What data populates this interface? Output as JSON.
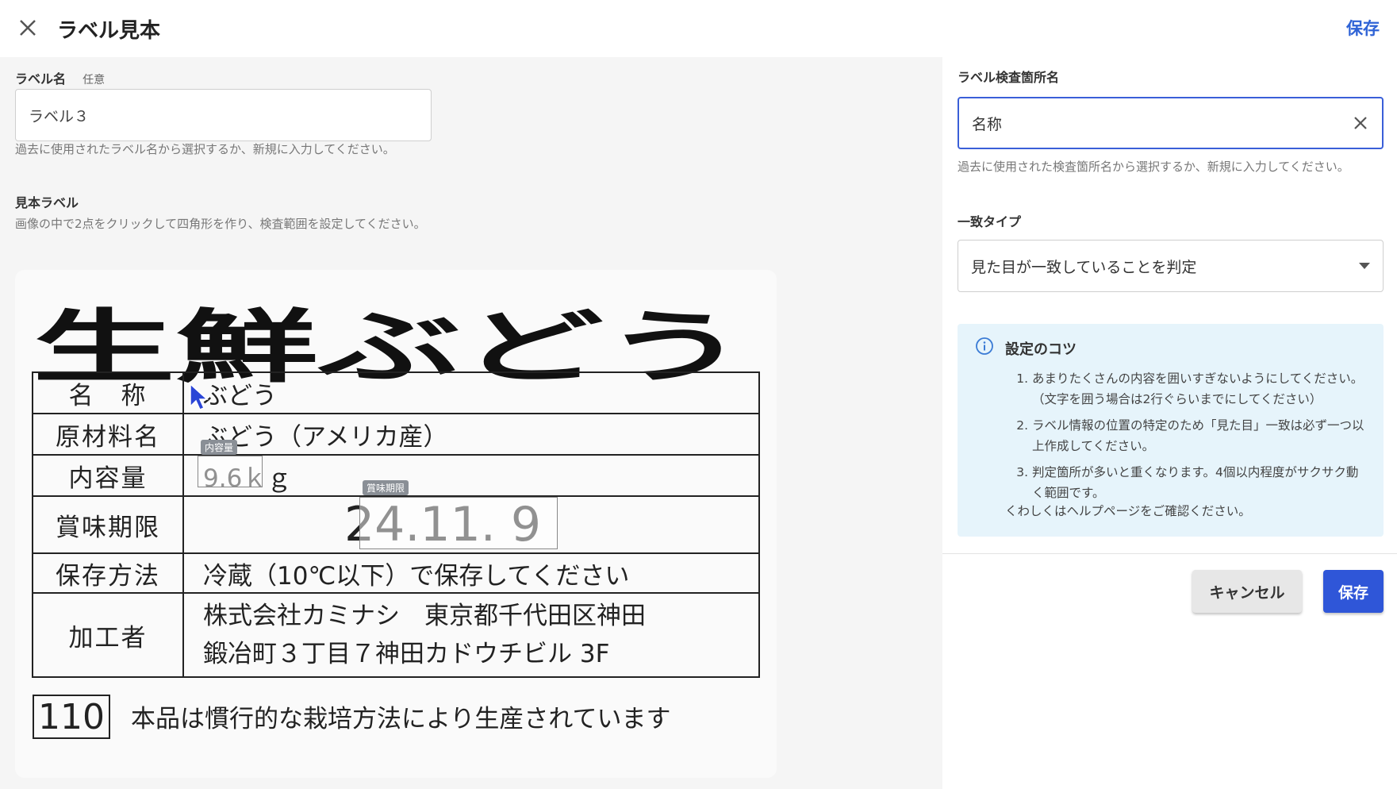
{
  "header": {
    "title": "ラベル見本",
    "save_label": "保存",
    "close_icon": "close-icon"
  },
  "left": {
    "label_name": {
      "label": "ラベル名",
      "optional": "任意",
      "value": "ラベル３",
      "help": "過去に使用されたラベル名から選択するか、新規に入力してください。"
    },
    "sample": {
      "label": "見本ラベル",
      "help": "画像の中で2点をクリックして四角形を作り、検査範囲を設定してください。",
      "image": {
        "title": "生鮮ぶどう",
        "rows": [
          {
            "head": "名　称",
            "value": "ぶどう"
          },
          {
            "head": "原材料名",
            "value": "ぶどう（アメリカ産）"
          },
          {
            "head": "内容量",
            "value": "9.6ｋｇ"
          },
          {
            "head": "賞味期限",
            "value": "24.11. 9"
          },
          {
            "head": "保存方法",
            "value": "冷蔵（10℃以下）で保存してください"
          },
          {
            "head": "加工者",
            "value_line1": "株式会社カミナシ　東京都千代田区神田",
            "value_line2": "鍛冶町３丁目７神田カドウチビル 3F"
          }
        ],
        "lot": "110",
        "footer_note": "本品は慣行的な栽培方法により生産されています",
        "roi_tags": [
          "内容量",
          "賞味期限"
        ]
      }
    }
  },
  "right": {
    "inspect_name": {
      "label": "ラベル検査箇所名",
      "value": "名称",
      "help": "過去に使用された検査箇所名から選択するか、新規に入力してください。"
    },
    "match_type": {
      "label": "一致タイプ",
      "selected": "見た目が一致していることを判定"
    },
    "tips": {
      "title": "設定のコツ",
      "items": [
        "あまりたくさんの内容を囲いすぎないようにしてください。（文字を囲う場合は2行ぐらいまでにしてください）",
        "ラベル情報の位置の特定のため「見た目」一致は必ず一つ以上作成してください。",
        "判定箇所が多いと重くなります。4個以内程度がサクサク動く範囲です。"
      ],
      "note": "くわしくはヘルプページをご確認ください。"
    },
    "buttons": {
      "cancel": "キャンセル",
      "save": "保存"
    }
  }
}
